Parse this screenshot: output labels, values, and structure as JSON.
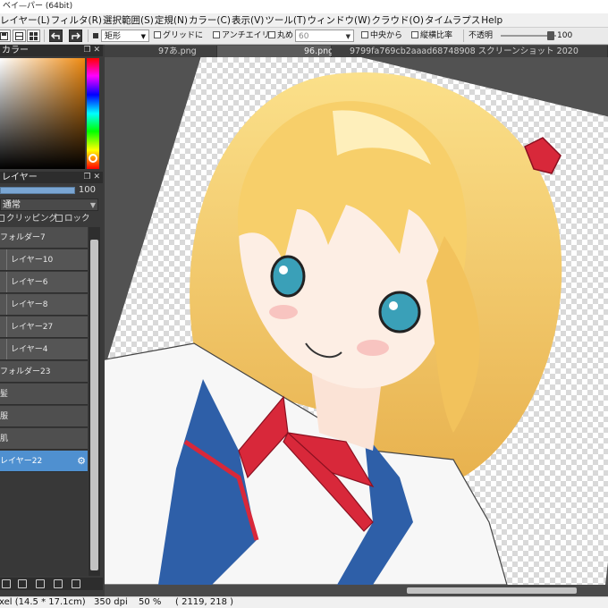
{
  "window": {
    "title": "ベイ—パー (64bit)"
  },
  "menu": [
    "レイヤー(L)",
    "フィルタ(R)",
    "選択範囲(S)",
    "定規(N)",
    "カラー(C)",
    "表示(V)",
    "ツール(T)",
    "ウィンドウ(W)",
    "クラウド(O)",
    "タイムラプス",
    "Help"
  ],
  "toolbar": {
    "shape_label": "矩形",
    "grid_label": "グリッドに",
    "antialias_label": "アンチエイリ",
    "rounded_label": "丸め",
    "rounded_value": "60",
    "center_label": "中央から",
    "aspect_label": "縦横比率",
    "opacity_label": "不透明",
    "opacity_value": "100"
  },
  "tabs": [
    "97あ.png",
    "96.png",
    "9799fa769cb2aaad68748908 スクリーンショット 2020"
  ],
  "color_panel": {
    "title": "カラー",
    "accent": "#ef8a10"
  },
  "layer_panel": {
    "title": "レイヤー",
    "opacity": "100",
    "opacity_fraction": 1.0,
    "blend_mode": "通常",
    "clipping_label": "クリッピング",
    "lock_label": "ロック",
    "layers": [
      {
        "name": "フォルダー7",
        "type": "folder",
        "indent": false,
        "selected": false
      },
      {
        "name": "レイヤー10",
        "type": "layer",
        "indent": true,
        "selected": false
      },
      {
        "name": "レイヤー6",
        "type": "layer",
        "indent": true,
        "selected": false
      },
      {
        "name": "レイヤー8",
        "type": "layer",
        "indent": true,
        "selected": false
      },
      {
        "name": "レイヤー27",
        "type": "layer",
        "indent": true,
        "selected": false
      },
      {
        "name": "レイヤー4",
        "type": "layer",
        "indent": true,
        "selected": false
      },
      {
        "name": "フォルダー23",
        "type": "folder",
        "indent": false,
        "selected": false
      },
      {
        "name": "髪",
        "type": "layer",
        "indent": false,
        "selected": false
      },
      {
        "name": "服",
        "type": "layer",
        "indent": false,
        "selected": false
      },
      {
        "name": "肌",
        "type": "layer",
        "indent": false,
        "selected": false
      },
      {
        "name": "レイヤー22",
        "type": "layer",
        "indent": false,
        "selected": true
      }
    ]
  },
  "status": {
    "size": "xel  (14.5 * 17.1cm)",
    "dpi": "350 dpi",
    "zoom": "50 %",
    "coords": "( 2119, 218 )"
  },
  "colors": {
    "selected_layer": "#4f90d0",
    "hair": "#f7cf6a",
    "ribbon": "#d8283a",
    "collar": "#2e5fa8"
  }
}
